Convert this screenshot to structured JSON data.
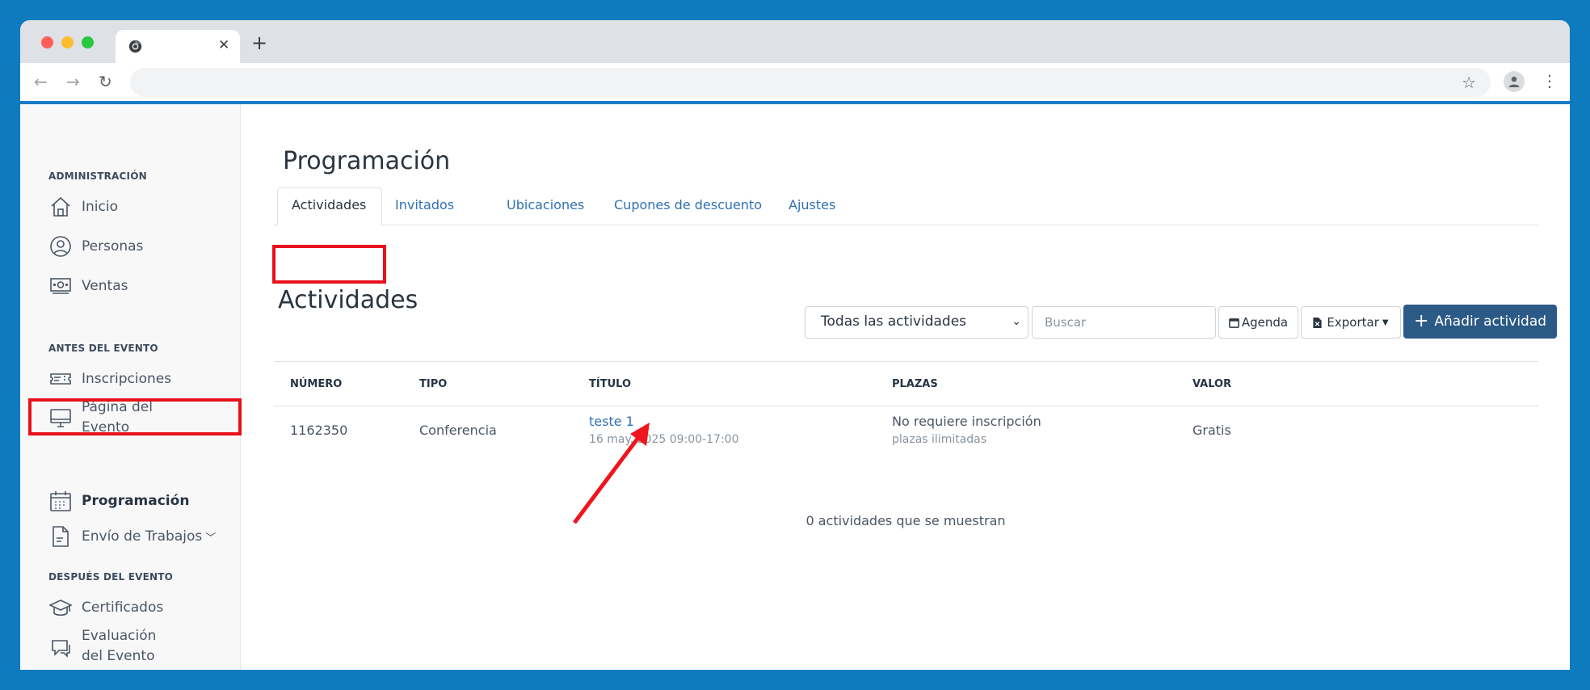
{
  "browser": {
    "tab_close": "✕",
    "new_tab": "+"
  },
  "sidebar": {
    "sections": [
      {
        "label": "ADMINISTRACIÓN"
      },
      {
        "label": "ANTES DEL EVENTO"
      },
      {
        "label": "DESPUÉS DEL EVENTO"
      }
    ],
    "items": [
      {
        "label": "Inicio",
        "icon": "home-icon"
      },
      {
        "label": "Personas",
        "icon": "person-circle-icon"
      },
      {
        "label": "Ventas",
        "icon": "money-icon"
      },
      {
        "label": "Inscripciones",
        "icon": "ticket-icon"
      },
      {
        "label": "Página del Evento",
        "icon": "monitor-icon"
      },
      {
        "label": "Programación",
        "icon": "calendar-icon",
        "active": true
      },
      {
        "label": "Envío de Trabajos",
        "icon": "document-icon"
      },
      {
        "label": "Certificados",
        "icon": "graduation-cap-icon"
      },
      {
        "label": "Evaluación del Evento",
        "icon": "chat-icon"
      }
    ]
  },
  "main": {
    "page_title": "Programación",
    "tabs": [
      {
        "label": "Actividades",
        "active": true
      },
      {
        "label": "Invitados"
      },
      {
        "label": "Ubicaciones"
      },
      {
        "label": "Cupones de descuento"
      },
      {
        "label": "Ajustes"
      }
    ],
    "section_title": "Actividades",
    "filter_select": {
      "value": "Todas las actividades"
    },
    "search": {
      "placeholder": "Buscar"
    },
    "buttons": {
      "agenda": "Agenda",
      "export": "Exportar",
      "add": "Añadir actividad"
    },
    "table": {
      "headers": [
        "NÚMERO",
        "TIPO",
        "TÍTULO",
        "PLAZAS",
        "VALOR"
      ],
      "rows": [
        {
          "number": "1162350",
          "type": "Conferencia",
          "title": "teste 1",
          "date": "16 may. 2025 09:00-17:00",
          "places": "No requiere inscripción",
          "places_sub": "plazas ilimitadas",
          "value": "Gratis"
        }
      ]
    },
    "count_text": "0 actividades que se muestran"
  },
  "colors": {
    "highlight": "#e8111c",
    "primary": "#2b5a86",
    "link": "#2f71b4",
    "background": "#0d7bbd"
  }
}
